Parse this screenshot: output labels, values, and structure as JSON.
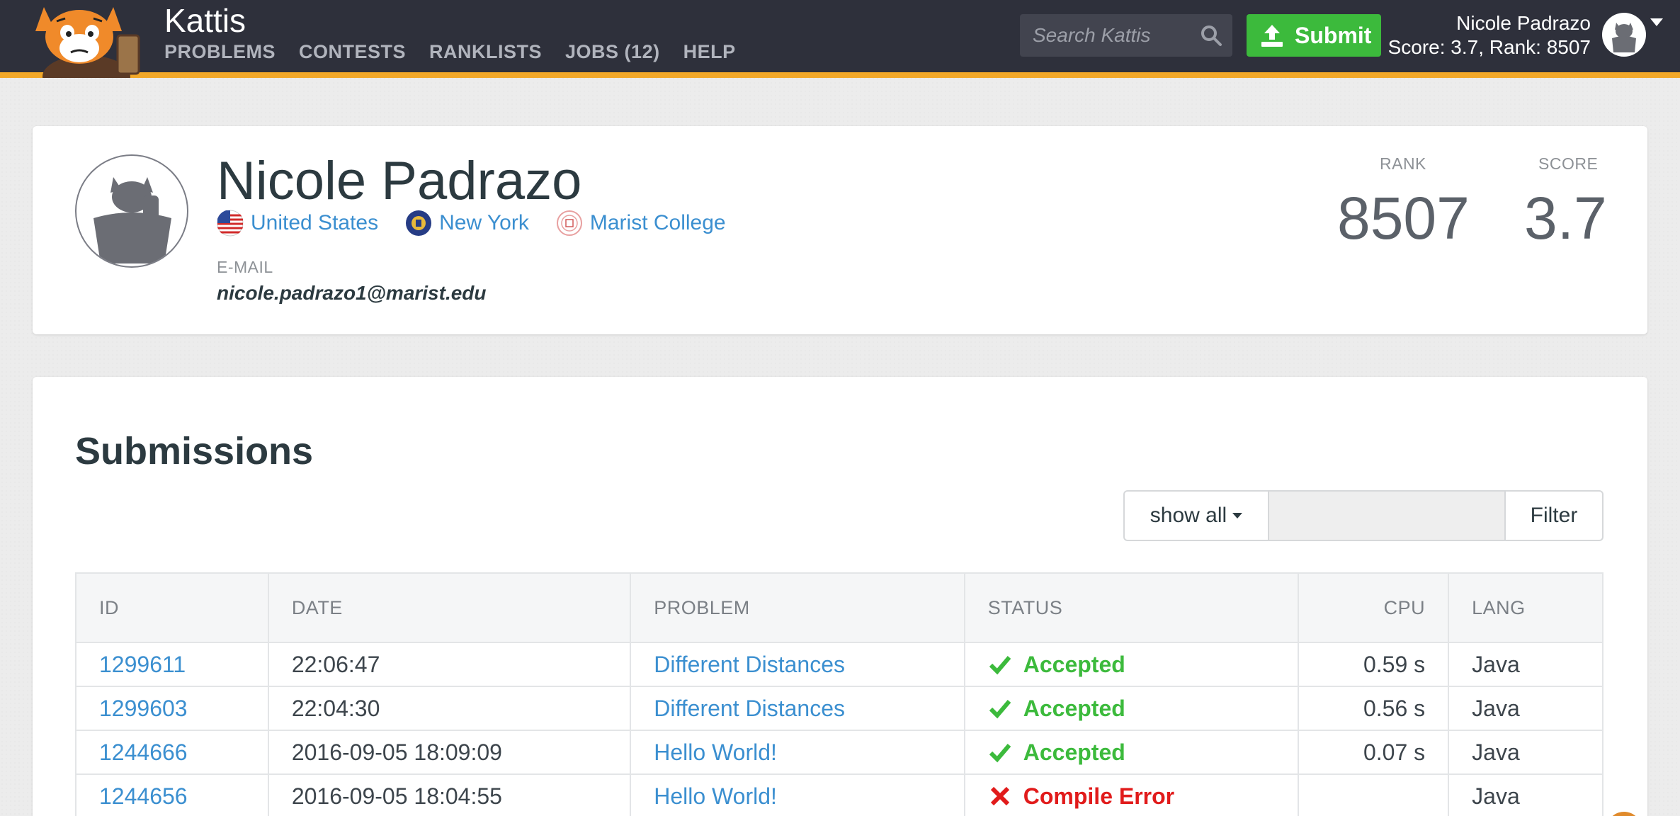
{
  "header": {
    "brand": "Kattis",
    "nav": [
      "PROBLEMS",
      "CONTESTS",
      "RANKLISTS",
      "JOBS (12)",
      "HELP"
    ],
    "search_placeholder": "Search Kattis",
    "submit_label": "Submit",
    "user_name": "Nicole Padrazo",
    "user_stats": "Score: 3.7, Rank: 8507"
  },
  "profile": {
    "name": "Nicole Padrazo",
    "country": "United States",
    "state": "New York",
    "school": "Marist College",
    "email_label": "E-MAIL",
    "email": "nicole.padrazo1@marist.edu",
    "rank_label": "RANK",
    "rank": "8507",
    "score_label": "SCORE",
    "score": "3.7"
  },
  "submissions": {
    "title": "Submissions",
    "filter_select": "show all",
    "filter_button": "Filter",
    "columns": [
      "ID",
      "DATE",
      "PROBLEM",
      "STATUS",
      "CPU",
      "LANG"
    ],
    "rows": [
      {
        "id": "1299611",
        "date": "22:06:47",
        "problem": "Different Distances",
        "status": "Accepted",
        "status_type": "ok",
        "cpu": "0.59 s",
        "lang": "Java"
      },
      {
        "id": "1299603",
        "date": "22:04:30",
        "problem": "Different Distances",
        "status": "Accepted",
        "status_type": "ok",
        "cpu": "0.56 s",
        "lang": "Java"
      },
      {
        "id": "1244666",
        "date": "2016-09-05 18:09:09",
        "problem": "Hello World!",
        "status": "Accepted",
        "status_type": "ok",
        "cpu": "0.07 s",
        "lang": "Java"
      },
      {
        "id": "1244656",
        "date": "2016-09-05 18:04:55",
        "problem": "Hello World!",
        "status": "Compile Error",
        "status_type": "err",
        "cpu": "",
        "lang": "Java"
      }
    ]
  },
  "colors": {
    "header_bg": "#2e303b",
    "header_accent": "#f2a829",
    "accepted": "#3cba3c",
    "error": "#e11b1b",
    "link": "#3b8fd0"
  }
}
